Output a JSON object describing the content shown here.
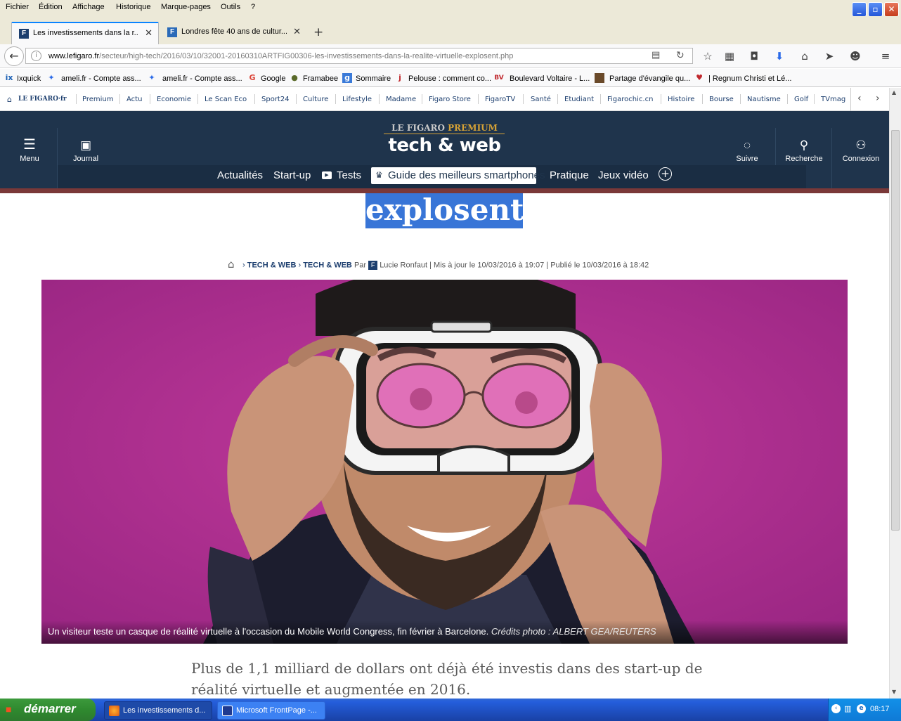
{
  "menubar": {
    "items": [
      "Fichier",
      "Édition",
      "Affichage",
      "Historique",
      "Marque-pages",
      "Outils",
      "?"
    ]
  },
  "tabs": [
    {
      "title": "Les investissements dans la r...",
      "active": true
    },
    {
      "title": "Londres fête 40 ans de cultur...",
      "active": false
    }
  ],
  "navbar": {
    "url_domain": "www.lefigaro.fr",
    "url_path": "/secteur/high-tech/2016/03/10/32001-20160310ARTFIG00306-les-investissements-dans-la-realite-virtuelle-explosent.php"
  },
  "bookmarks": [
    "Ixquick",
    "ameli.fr - Compte ass...",
    "ameli.fr - Compte ass...",
    "Google",
    "Framabee",
    "Sommaire",
    "Pelouse : comment co...",
    "Boulevard Voltaire - L...",
    "Partage d'évangile qu...",
    "| Regnum Christi et Lé..."
  ],
  "site_nav": {
    "logo": "LE FIGARO·fr",
    "items": [
      "Premium",
      "Actu",
      "Economie",
      "Le Scan Eco",
      "Sport24",
      "Culture",
      "Lifestyle",
      "Madame",
      "Figaro Store",
      "FigaroTV",
      "Santé",
      "Etudiant",
      "Figarochic.cn",
      "Histoire",
      "Bourse",
      "Nautisme",
      "Golf",
      "TVmag"
    ]
  },
  "header": {
    "brand_plain": "LE FIGARO",
    "brand_gold": "PREMIUM",
    "section": "tech & web",
    "menu_label": "Menu",
    "journal_label": "Journal",
    "follow_label": "Suivre",
    "search_label": "Recherche",
    "login_label": "Connexion",
    "subnav": [
      "Actualités",
      "Start-up",
      "Tests",
      "Guide des meilleurs smartphones",
      "Pratique",
      "Jeux vidéo"
    ]
  },
  "article": {
    "headline_fragment": "explosent",
    "breadcrumb_1": "TECH & WEB",
    "breadcrumb_2": "TECH & WEB",
    "by": "Par",
    "author": "Lucie Ronfaut",
    "updated": "| Mis à jour le 10/03/2016 à 19:07",
    "published": "| Publié le 10/03/2016 à 18:42",
    "caption": "Un visiteur teste un casque de réalité virtuelle à l'occasion du Mobile World Congress, fin février à Barcelone.",
    "credit": "Crédits photo : ALBERT GEA/REUTERS",
    "lede": "Plus de 1,1 milliard de dollars ont déjà été investis dans des start-up de réalité virtuelle et augmentée en 2016."
  },
  "taskbar": {
    "start_label": "démarrer",
    "tasks": [
      "Les investissements d...",
      "Microsoft FrontPage -..."
    ],
    "clock": "08:17"
  },
  "colors": {
    "header_bg": "#1f344c",
    "accent_red": "#7a3838",
    "selection_blue": "#3875d7",
    "photo_bg": "#b0308f"
  }
}
